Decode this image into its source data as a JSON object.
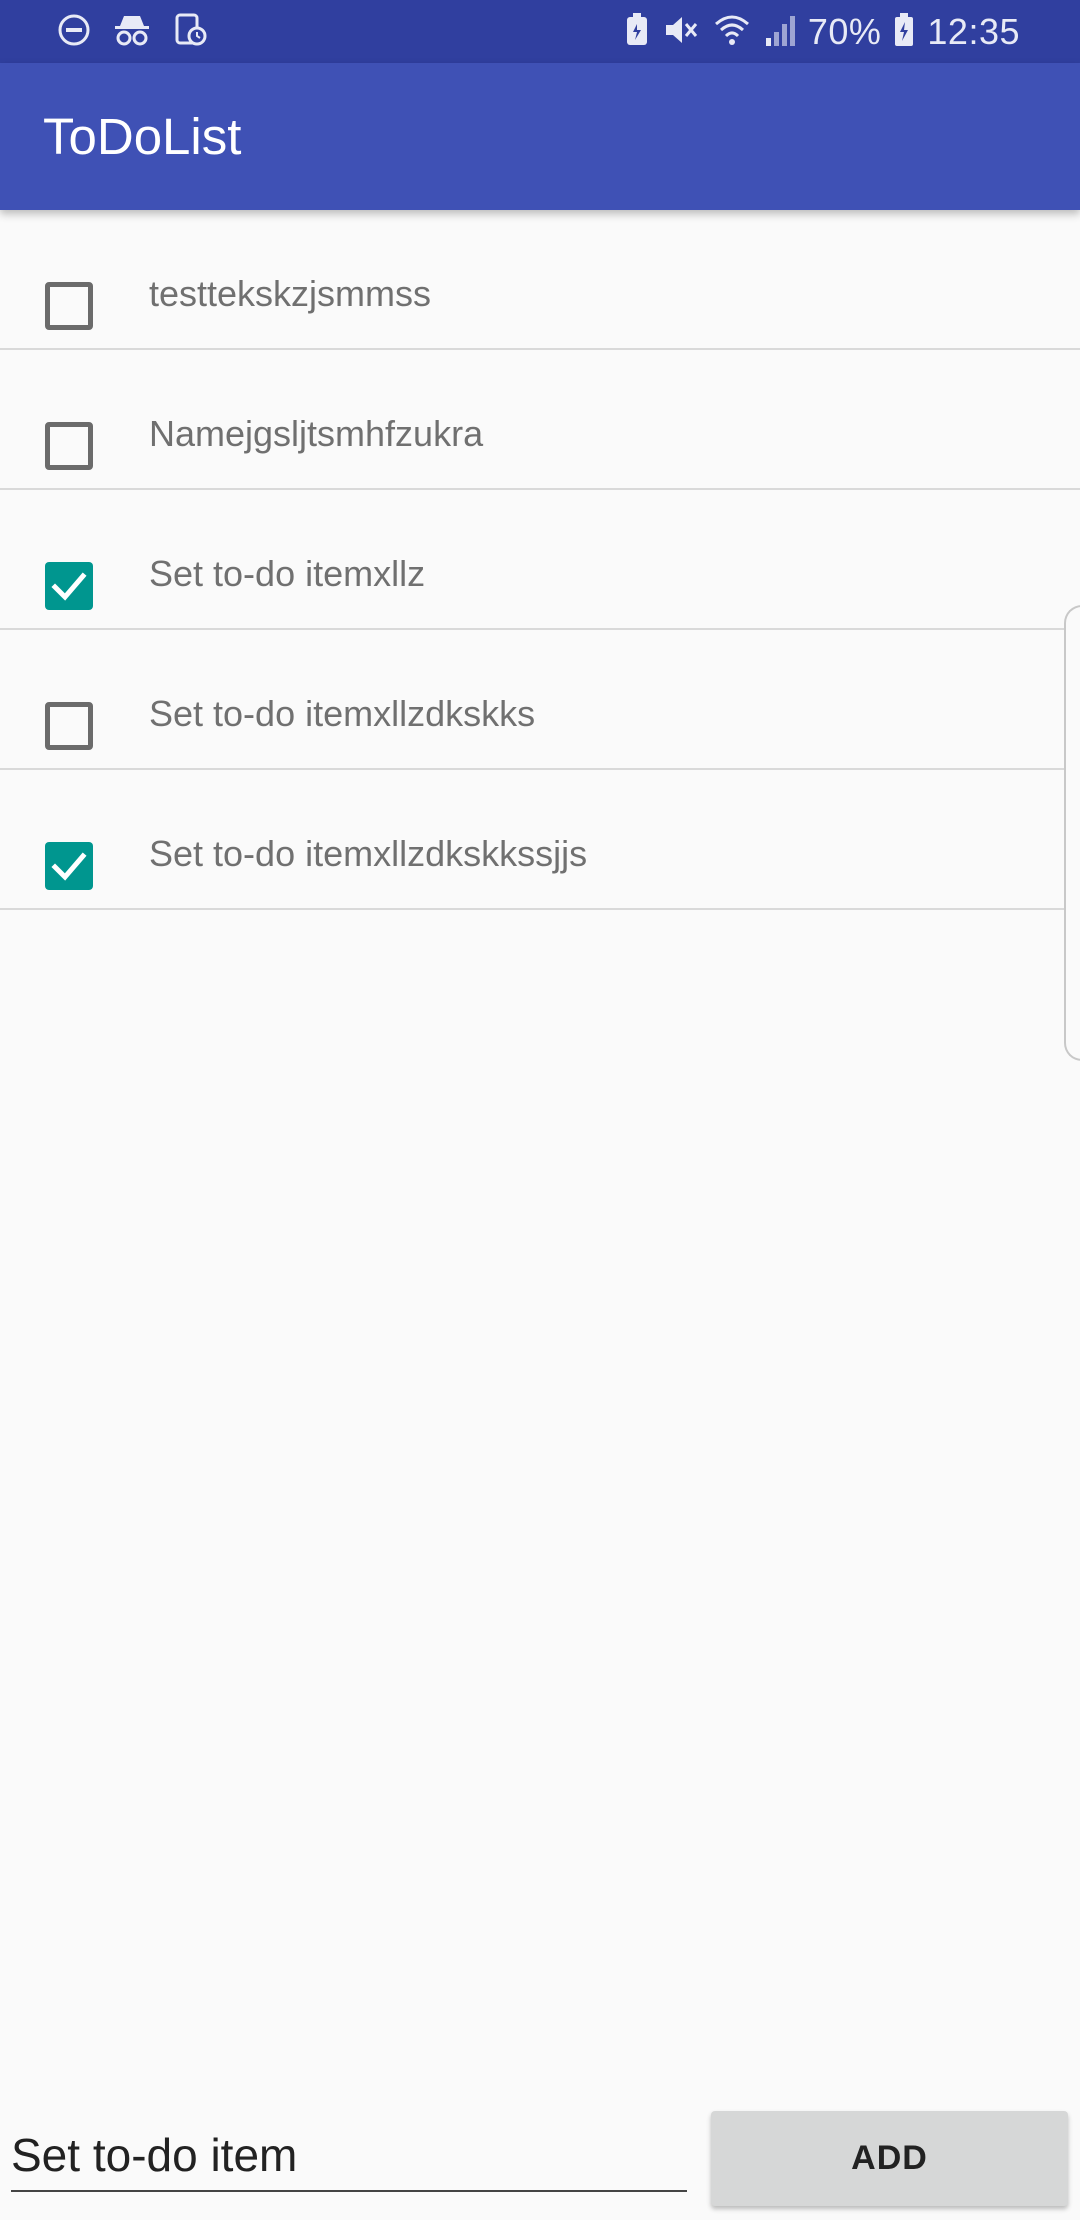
{
  "status_bar": {
    "battery": "70%",
    "time": "12:35",
    "icons_left": [
      "do-not-disturb-icon",
      "incognito-icon",
      "screen-time-icon"
    ],
    "icons_right": [
      "battery-saver-icon",
      "mute-icon",
      "wifi-icon",
      "signal-icon",
      "battery-icon"
    ]
  },
  "app_bar": {
    "title": "ToDoList"
  },
  "todos": [
    {
      "label": "testtekskzjsmmss",
      "checked": false
    },
    {
      "label": "Namejgsljtsmhfzukra",
      "checked": false
    },
    {
      "label": "Set to-do itemxllz",
      "checked": true
    },
    {
      "label": "Set to-do itemxllzdkskks",
      "checked": false
    },
    {
      "label": "Set to-do itemxllzdkskkssjjs",
      "checked": true
    }
  ],
  "new_item": {
    "placeholder": "Set to-do item",
    "value": ""
  },
  "add_button": {
    "label": "ADD"
  },
  "colors": {
    "status_bar": "#303f9f",
    "app_bar": "#3f51b5",
    "checkbox_checked": "#00968f",
    "background": "#fafafa"
  }
}
